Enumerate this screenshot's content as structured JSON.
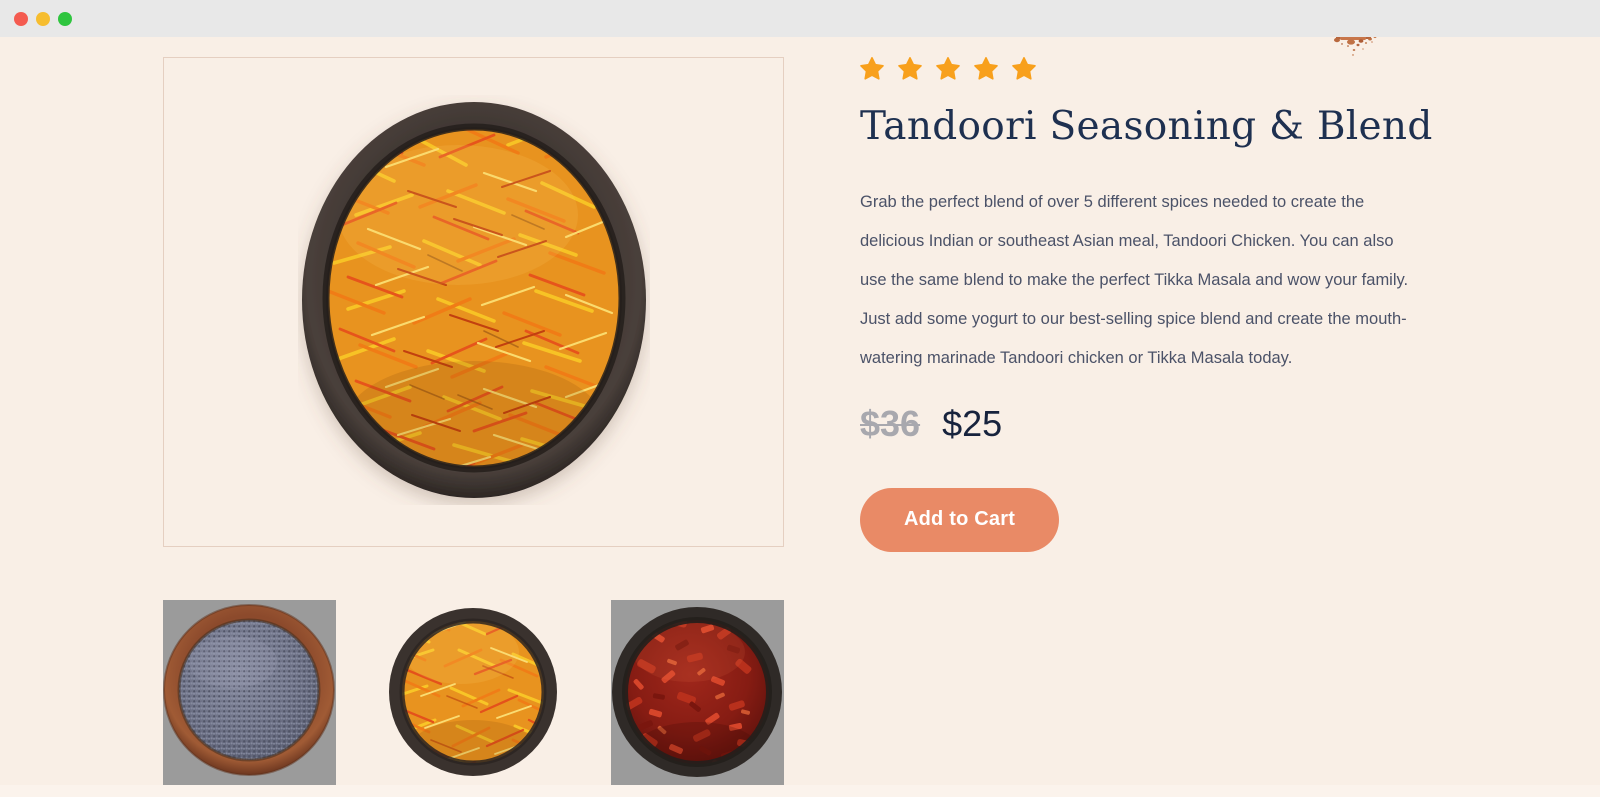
{
  "window": {
    "traffic_lights": [
      {
        "name": "close",
        "color": "#f45b50"
      },
      {
        "name": "minimize",
        "color": "#f6bd2f"
      },
      {
        "name": "maximize",
        "color": "#2fc53f"
      }
    ],
    "titlebar_color": "#e8e8e8",
    "background_color": "#f9efe6"
  },
  "gallery": {
    "hero": {
      "alt": "Tandoori seasoning blend of orange and yellow safflower threads in a dark bowl",
      "icon": "spice-bowl-saffron",
      "background": "#f9efe6",
      "border_color": "#e5cfc1"
    },
    "thumbnails": [
      {
        "alt": "Blue poppy seeds in a rust clay bowl",
        "icon": "spice-bowl-poppy-seed",
        "background": "#9b9b9b",
        "selected": false
      },
      {
        "alt": "Orange and yellow safflower threads in a dark bowl",
        "icon": "spice-bowl-saffron",
        "background": "#f9efe6",
        "selected": true
      },
      {
        "alt": "Dark red chili flakes in a dark bowl",
        "icon": "spice-bowl-chili-flakes",
        "background": "#9b9b9b",
        "selected": false
      }
    ]
  },
  "details": {
    "rating": {
      "value": 5,
      "max": 5,
      "star_color": "#f8a01c"
    },
    "title": "Tandoori Seasoning & Blend",
    "description": "Grab the perfect blend of over 5 different spices needed to create the delicious Indian or southeast Asian meal, Tandoori Chicken. You can also use the same blend to make the perfect Tikka Masala and wow your family. Just add some yogurt to our best-selling spice blend and create the mouth-watering marinade Tandoori chicken or Tikka Masala today.",
    "price": {
      "original": "$36",
      "current": "$25",
      "original_color": "#a8a8ae",
      "current_color": "#17233d"
    },
    "cta": {
      "label": "Add to Cart",
      "background": "#e98a66",
      "text_color": "#ffffff"
    }
  },
  "decor": {
    "corner_scatter": "spice-scatter-icon"
  }
}
